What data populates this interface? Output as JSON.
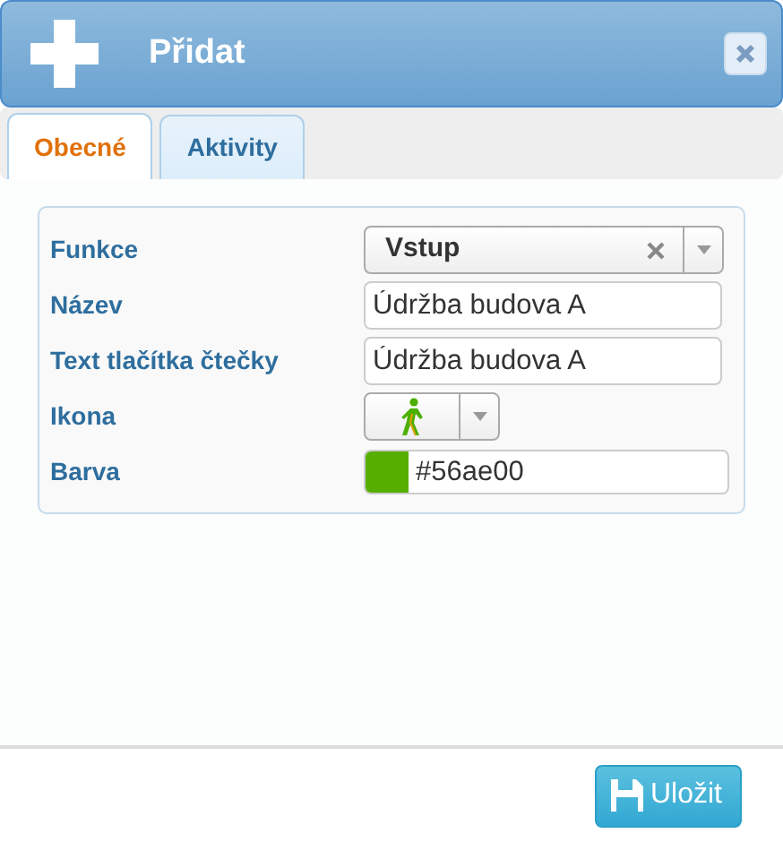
{
  "dialog": {
    "title": "Přidat"
  },
  "tabs": [
    {
      "label": "Obecné",
      "selected": true
    },
    {
      "label": "Aktivity",
      "selected": false
    }
  ],
  "fields": [
    {
      "kind": "select",
      "label": "Funkce",
      "value": "Vstup"
    },
    {
      "kind": "text",
      "label": "Název",
      "value": "Údržba budova A"
    },
    {
      "kind": "text",
      "label": "Text tlačítka čtečky",
      "value": "Údržba budova A"
    },
    {
      "kind": "icon-select",
      "label": "Ikona"
    },
    {
      "kind": "color",
      "label": "Barva",
      "value": "#56ae00",
      "color": "#56ae00"
    }
  ],
  "buttons": [
    {
      "label": "Uložit"
    }
  ]
}
